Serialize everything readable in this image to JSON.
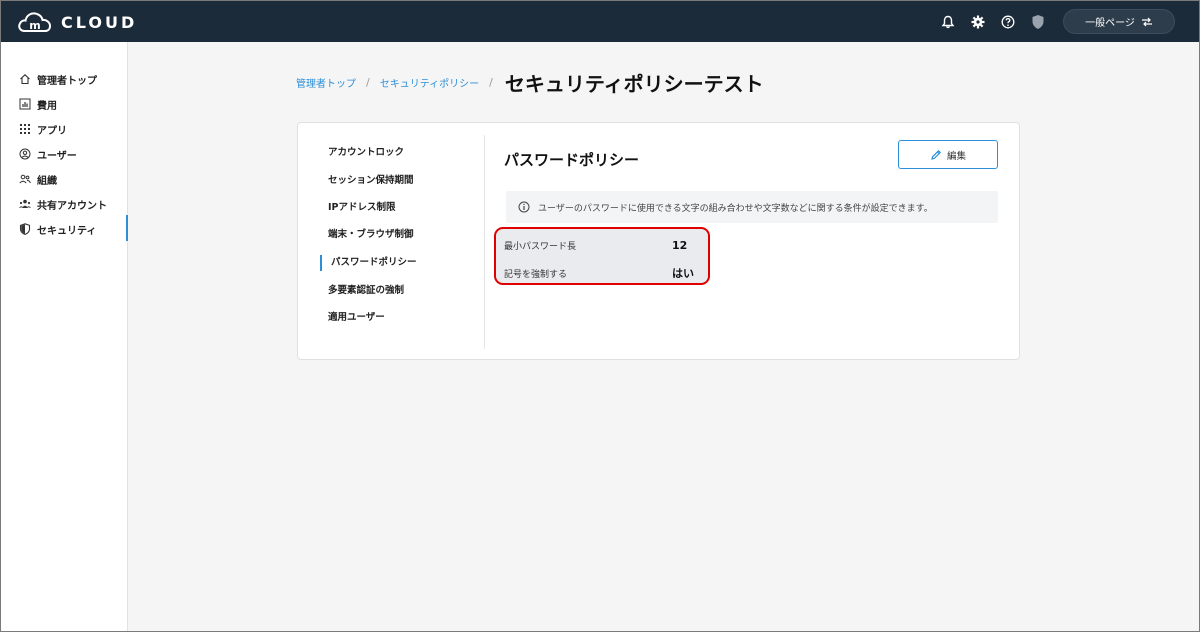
{
  "header": {
    "logo_text": "CLOUD",
    "logo_mark": "m",
    "page_switch_label": "一般ページ"
  },
  "sidebar": {
    "items": [
      {
        "label": "管理者トップ",
        "icon": "home-icon"
      },
      {
        "label": "費用",
        "icon": "chart-icon"
      },
      {
        "label": "アプリ",
        "icon": "apps-grid-icon"
      },
      {
        "label": "ユーザー",
        "icon": "user-circle-icon"
      },
      {
        "label": "組織",
        "icon": "group-icon"
      },
      {
        "label": "共有アカウント",
        "icon": "shared-account-icon"
      },
      {
        "label": "セキュリティ",
        "icon": "shield-icon",
        "active": true
      }
    ]
  },
  "breadcrumb": {
    "items": [
      "管理者トップ",
      "セキュリティポリシー"
    ],
    "separator": "/",
    "current": "セキュリティポリシーテスト"
  },
  "policy_menu": {
    "items": [
      "アカウントロック",
      "セッション保持期間",
      "IPアドレス制限",
      "端末・ブラウザ制御",
      "パスワードポリシー",
      "多要素認証の強制",
      "適用ユーザー"
    ],
    "active": "パスワードポリシー"
  },
  "section": {
    "title": "パスワードポリシー",
    "edit_label": "編集",
    "info_text": "ユーザーのパスワードに使用できる文字の組み合わせや文字数などに関する条件が設定できます。"
  },
  "policy": {
    "rows": [
      {
        "label": "最小パスワード長",
        "value": "12"
      },
      {
        "label": "記号を強制する",
        "value": "はい"
      }
    ]
  },
  "colors": {
    "header_bg": "#1c2b3a",
    "accent": "#2d8fd8",
    "highlight_border": "#e00000"
  }
}
